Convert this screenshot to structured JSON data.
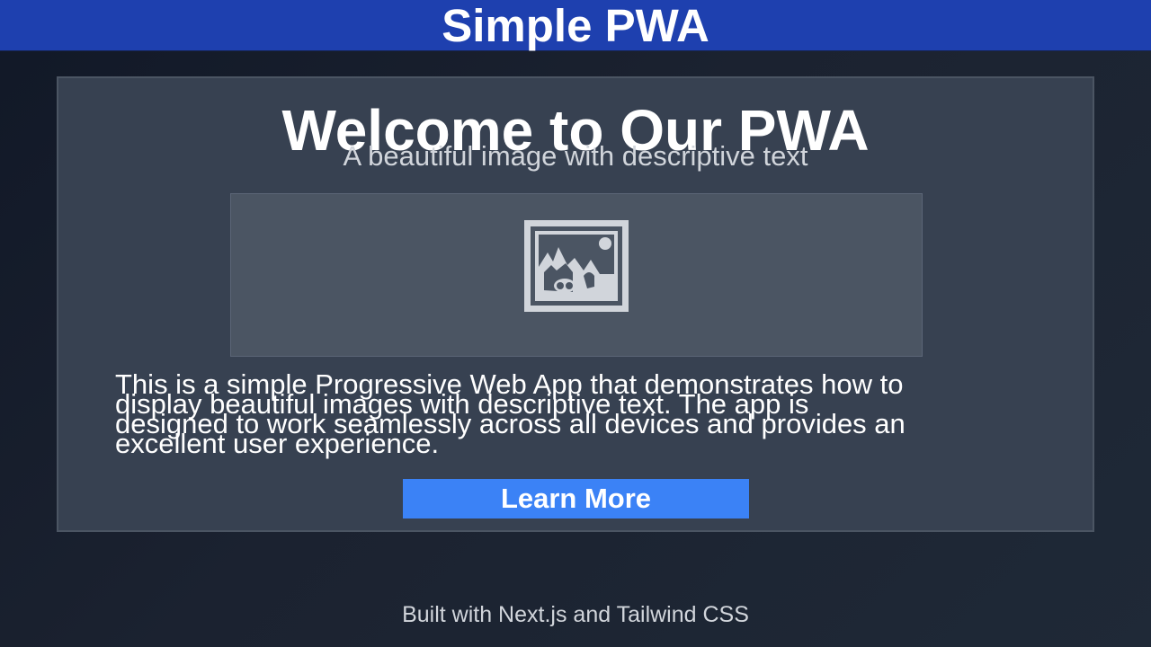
{
  "header": {
    "title": "Simple PWA"
  },
  "hero": {
    "title": "Welcome to Our PWA",
    "subtitle": "A beautiful image with descriptive text",
    "image_icon": "image-placeholder-icon",
    "description": "This is a simple Progressive Web App that demonstrates how to display beautiful images with descriptive text. The app is designed to work seamlessly across all devices and provides an excellent user experience.",
    "button_label": "Learn More"
  },
  "footer": {
    "text": "Built with Next.js and Tailwind CSS"
  },
  "colors": {
    "header_bg": "#1e40af",
    "page_bg": "#1f2937",
    "card_bg": "#374151",
    "image_bg": "#4b5563",
    "button_bg": "#3b82f6"
  }
}
